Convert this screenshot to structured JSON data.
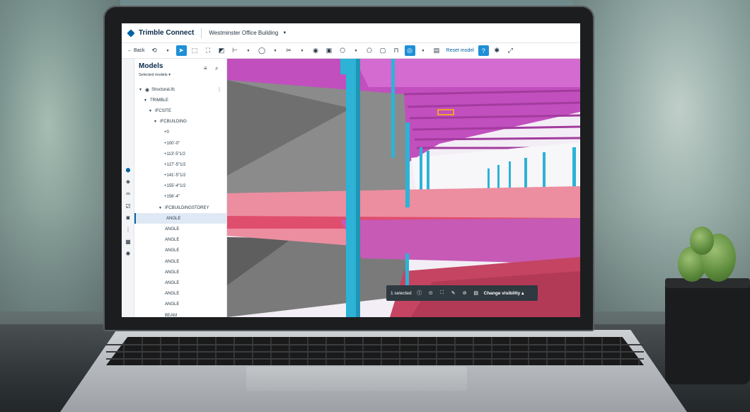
{
  "app": {
    "brand": "Trimble Connect",
    "project": "Westminster Office Building"
  },
  "toolbar": {
    "back_label": "Back",
    "reset_label": "Reset model",
    "icons": [
      "rotate-icon",
      "select-icon",
      "box-select-icon",
      "frame-icon",
      "section-icon",
      "measure-icon",
      "shape-icon",
      "clip-icon",
      "snapshot-icon",
      "markup-icon",
      "cube-icon",
      "comment-icon",
      "clip-box-icon",
      "lock-icon",
      "eye-icon",
      "grid-icon",
      "help-icon",
      "settings-icon",
      "fullscreen-icon"
    ]
  },
  "sidebar_icons": [
    "cube-icon",
    "layers-icon",
    "link-icon",
    "checklist-icon",
    "camera-icon",
    "tree-icon",
    "table-icon",
    "gear-icon"
  ],
  "models_panel": {
    "title": "Models",
    "subtitle": "Selected models",
    "tree": [
      {
        "label": "Structural.ifc",
        "depth": 0,
        "selected": false
      },
      {
        "label": "TRIMBLE",
        "depth": 1,
        "selected": false
      },
      {
        "label": "IFCSITE",
        "depth": 2,
        "selected": false
      },
      {
        "label": "IFCBUILDING",
        "depth": 3,
        "selected": false
      },
      {
        "label": "+0",
        "depth": 4,
        "selected": false
      },
      {
        "label": "+100'-0\"",
        "depth": 4,
        "selected": false
      },
      {
        "label": "+113'-5\"1/2",
        "depth": 4,
        "selected": false
      },
      {
        "label": "+127'-5\"1/2",
        "depth": 4,
        "selected": false
      },
      {
        "label": "+141'-5\"1/2",
        "depth": 4,
        "selected": false
      },
      {
        "label": "+155'-4\"1/2",
        "depth": 4,
        "selected": false
      },
      {
        "label": "+156'-4\"",
        "depth": 4,
        "selected": false
      },
      {
        "label": "IFCBUILDINGSTOREY",
        "depth": 4,
        "selected": false
      },
      {
        "label": "ANGLE",
        "depth": 5,
        "selected": true
      },
      {
        "label": "ANGLE",
        "depth": 5,
        "selected": false
      },
      {
        "label": "ANGLE",
        "depth": 5,
        "selected": false
      },
      {
        "label": "ANGLE",
        "depth": 5,
        "selected": false
      },
      {
        "label": "ANGLE",
        "depth": 5,
        "selected": false
      },
      {
        "label": "ANGLE",
        "depth": 5,
        "selected": false
      },
      {
        "label": "ANGLE",
        "depth": 5,
        "selected": false
      },
      {
        "label": "ANGLE",
        "depth": 5,
        "selected": false
      },
      {
        "label": "ANGLE",
        "depth": 5,
        "selected": false
      },
      {
        "label": "BEAM",
        "depth": 5,
        "selected": false
      }
    ]
  },
  "selection_bar": {
    "selected_text": "1 selected",
    "visibility_label": "Change visibility"
  },
  "colors": {
    "accent": "#0063a3",
    "active_tool": "#1f8fd6",
    "steel_magenta": "#c23fb8",
    "column_cyan": "#2cb3d6",
    "floor_red": "#c94a68",
    "concrete_gray": "#8a8a8a"
  }
}
